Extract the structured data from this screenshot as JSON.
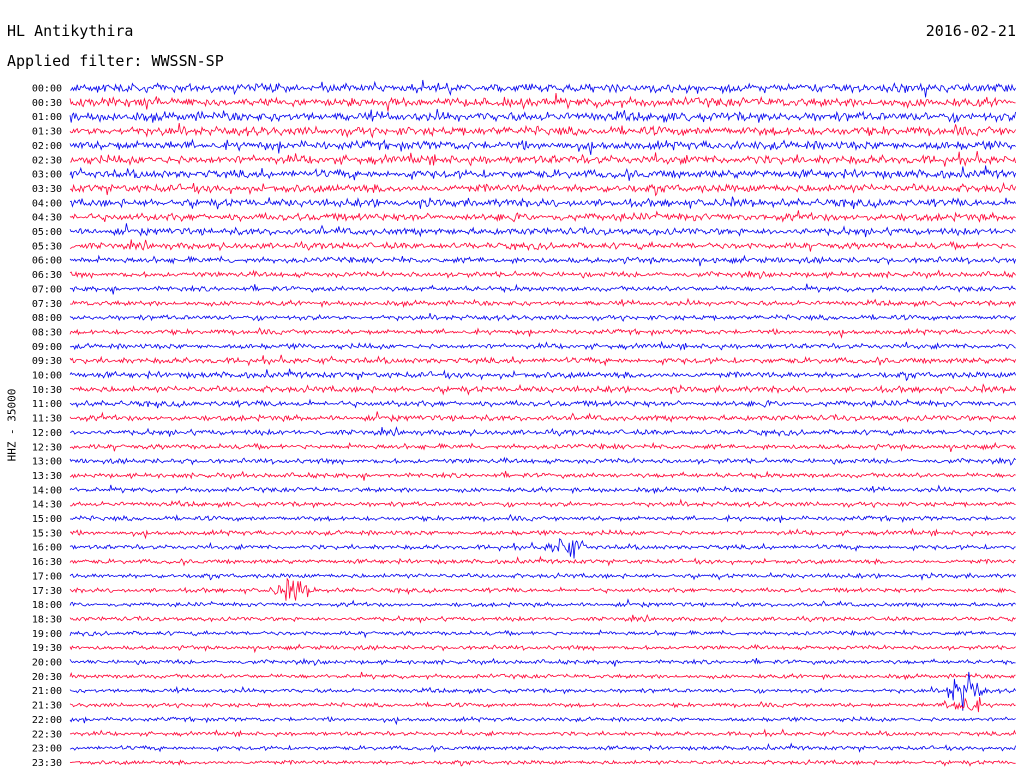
{
  "header": {
    "station": "HL Antikythira",
    "date": "2016-02-21",
    "filter": "Applied filter: WWSSN-SP"
  },
  "chart_data": {
    "type": "line",
    "title": "HL Antikythira",
    "date": "2016-02-21",
    "subtitle": "Applied filter: WWSSN-SP",
    "ylabel": "HHZ - 35000",
    "xlabel": "",
    "grid": false,
    "row_labels": [
      "00:00",
      "00:30",
      "01:00",
      "01:30",
      "02:00",
      "02:30",
      "03:00",
      "03:30",
      "04:00",
      "04:30",
      "05:00",
      "05:30",
      "06:00",
      "06:30",
      "07:00",
      "07:30",
      "08:00",
      "08:30",
      "09:00",
      "09:30",
      "10:00",
      "10:30",
      "11:00",
      "11:30",
      "12:00",
      "12:30",
      "13:00",
      "13:30",
      "14:00",
      "14:30",
      "15:00",
      "15:30",
      "16:00",
      "16:30",
      "17:00",
      "17:30",
      "18:00",
      "18:30",
      "19:00",
      "19:30",
      "20:00",
      "20:30",
      "21:00",
      "21:30",
      "22:00",
      "22:30",
      "23:00",
      "23:30"
    ],
    "series_colors": [
      "#0000ee",
      "#ff0033"
    ],
    "row_noise_level": [
      0.62,
      0.65,
      0.66,
      0.64,
      0.64,
      0.63,
      0.6,
      0.58,
      0.57,
      0.55,
      0.5,
      0.46,
      0.42,
      0.38,
      0.36,
      0.36,
      0.36,
      0.36,
      0.38,
      0.42,
      0.44,
      0.44,
      0.42,
      0.4,
      0.38,
      0.36,
      0.35,
      0.34,
      0.34,
      0.34,
      0.34,
      0.34,
      0.33,
      0.32,
      0.32,
      0.32,
      0.3,
      0.3,
      0.3,
      0.3,
      0.3,
      0.3,
      0.3,
      0.3,
      0.3,
      0.3,
      0.3,
      0.3
    ],
    "events": [
      {
        "row": 32,
        "x": 0.525,
        "amplitude": 1.8
      },
      {
        "row": 35,
        "x": 0.235,
        "amplitude": 1.8
      },
      {
        "row": 42,
        "x": 0.945,
        "amplitude": 3.0
      },
      {
        "row": 43,
        "x": 0.945,
        "amplitude": 1.8
      }
    ]
  }
}
